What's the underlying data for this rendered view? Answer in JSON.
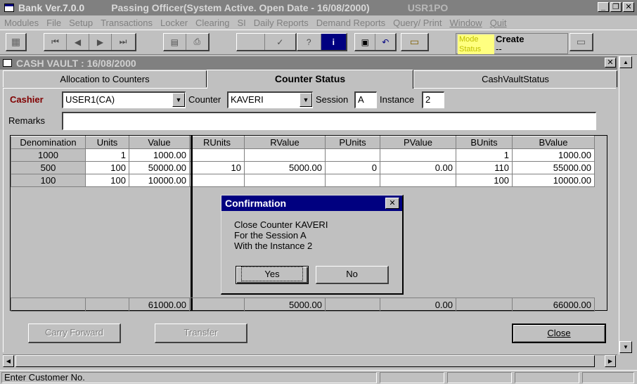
{
  "app": {
    "title_app": "Bank Ver.7.0.0",
    "title_role": "Passing Officer(System Active. Open Date - 16/08/2000)",
    "title_user": "USR1PO"
  },
  "menu": [
    "Modules",
    "File",
    "Setup",
    "Transactions",
    "Locker",
    "Clearing",
    "SI",
    "Daily Reports",
    "Demand Reports",
    "Query/ Print",
    "Window",
    "Quit"
  ],
  "toolbar": {
    "mode_label": "Mode",
    "status_label": "Status",
    "mode_value": "Create",
    "status_value": "--"
  },
  "child": {
    "title": "CASH VAULT : 16/08/2000"
  },
  "tabs": [
    "Allocation to Counters",
    "Counter Status",
    "CashVaultStatus"
  ],
  "form": {
    "cashier_label": "Cashier",
    "cashier_value": "USER1(CA)",
    "counter_label": "Counter",
    "counter_value": "KAVERI",
    "session_label": "Session",
    "session_value": "A",
    "instance_label": "Instance",
    "instance_value": "2",
    "remarks_label": "Remarks",
    "remarks_value": ""
  },
  "grid": {
    "headers": [
      "Denomination",
      "Units",
      "Value",
      "RUnits",
      "RValue",
      "PUnits",
      "PValue",
      "BUnits",
      "BValue"
    ],
    "rows": [
      [
        "1000",
        "1",
        "1000.00",
        "",
        "",
        "",
        "",
        "1",
        "1000.00"
      ],
      [
        "500",
        "100",
        "50000.00",
        "10",
        "5000.00",
        "0",
        "0.00",
        "110",
        "55000.00"
      ],
      [
        "100",
        "100",
        "10000.00",
        "",
        "",
        "",
        "",
        "100",
        "10000.00"
      ]
    ],
    "totals": [
      "",
      "",
      "61000.00",
      "",
      "5000.00",
      "",
      "0.00",
      "",
      "66000.00"
    ]
  },
  "buttons": {
    "carry_forward": "Carry Forward",
    "transfer": "Transfer",
    "close": "Close"
  },
  "dialog": {
    "title": "Confirmation",
    "line1": "Close Counter KAVERI",
    "line2": "For the Session A",
    "line3": "With the Instance  2",
    "yes": "Yes",
    "no": "No"
  },
  "statusbar": {
    "message": "Enter Customer No."
  }
}
